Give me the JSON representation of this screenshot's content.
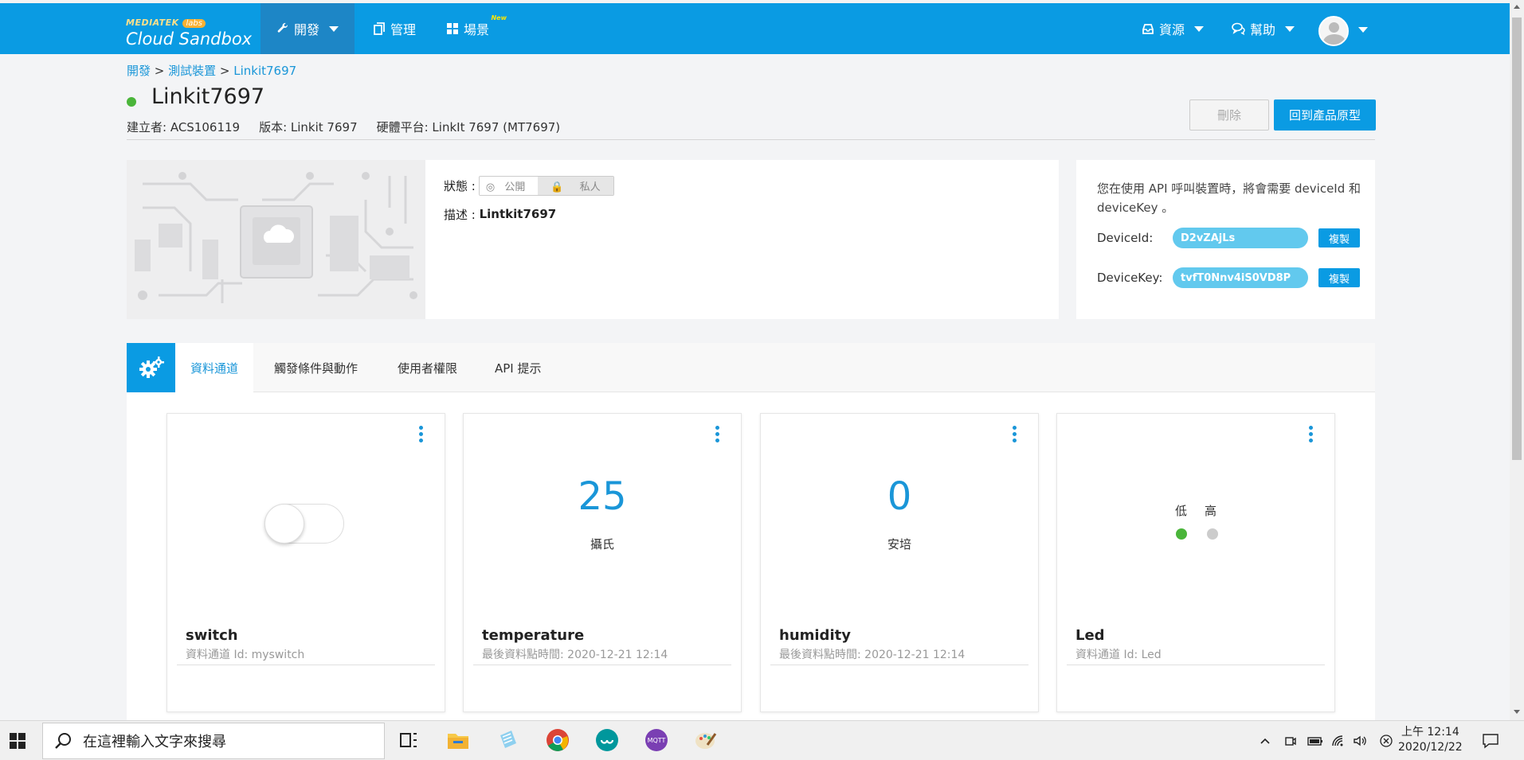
{
  "brand": {
    "company": "MEDIATEK",
    "labs": "labs",
    "product": "Cloud Sandbox"
  },
  "nav": {
    "develop": "開發",
    "manage": "管理",
    "scenes": "場景",
    "scenes_badge": "New",
    "resources": "資源",
    "help": "幫助"
  },
  "breadcrumb": {
    "root": "開發",
    "sep1": " > ",
    "middle": "測試裝置",
    "sep2": " > ",
    "current": "Linkit7697"
  },
  "device": {
    "title": "Linkit7697",
    "status_color": "#4ab53a",
    "creator": "建立者: ACS106119",
    "version": "版本: Linkit 7697",
    "platform": "硬體平台: LinkIt 7697 (MT7697)",
    "delete_label": "刪除",
    "back_label": "回到產品原型"
  },
  "info": {
    "status_label": "狀態 :",
    "public_label": "公開",
    "private_label": "私人",
    "desc_label": "描述 :",
    "desc_value": "Lintkit7697",
    "pcb_logo_text": "Cloud Sandbox"
  },
  "api": {
    "note": "您在使用 API 呼叫裝置時，將會需要 deviceId 和 deviceKey 。",
    "device_id_label": "DeviceId:",
    "device_id_value": "D2vZAjLs",
    "device_key_label": "DeviceKey:",
    "device_key_value": "tvfT0Nnv4iS0VD8P",
    "copy_label": "複製"
  },
  "tabs": [
    {
      "label": "資料通道"
    },
    {
      "label": "觸發條件與動作"
    },
    {
      "label": "使用者權限"
    },
    {
      "label": "API 提示"
    }
  ],
  "channels": {
    "switch": {
      "name": "switch",
      "sub": "資料通道 Id: myswitch",
      "state": "off"
    },
    "temperature": {
      "name": "temperature",
      "value": "25",
      "unit": "攝氏",
      "sub": "最後資料點時間: 2020-12-21 12:14"
    },
    "humidity": {
      "name": "humidity",
      "value": "0",
      "unit": "安培",
      "sub": "最後資料點時間: 2020-12-21 12:14"
    },
    "led": {
      "name": "Led",
      "low_label": "低",
      "high_label": "高",
      "sub": "資料通道 Id: Led",
      "low_color": "#4ab53a",
      "high_color": "#cccccc"
    }
  },
  "taskbar": {
    "search_placeholder": "在這裡輸入文字來搜尋",
    "time": "上午 12:14",
    "date": "2020/12/22"
  },
  "colors": {
    "accent": "#0a9be3",
    "link": "#1a96d8"
  }
}
